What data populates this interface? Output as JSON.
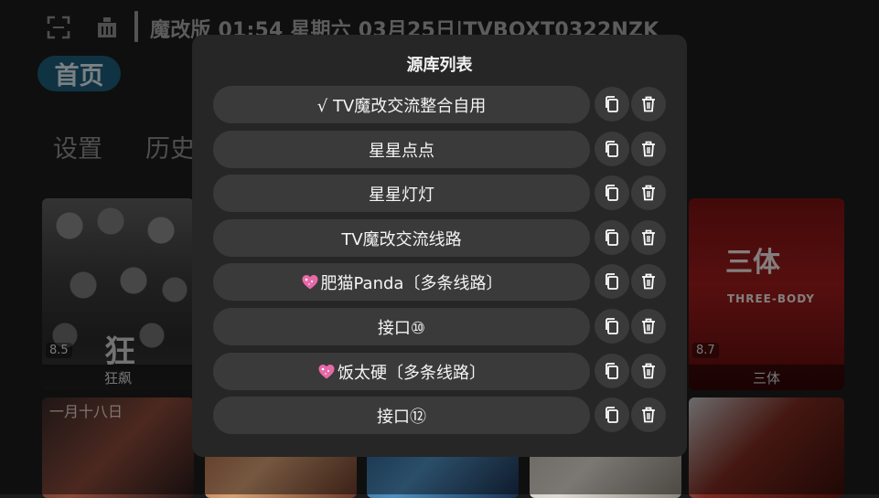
{
  "header": {
    "title_line": "魔改版 01:54 星期六 03月25日|TVBOXT0322NZK"
  },
  "nav": {
    "home": "首页",
    "settings": "设置",
    "history": "历史"
  },
  "posters": [
    {
      "title": "狂飙",
      "rating": "8.5",
      "art_text": "狂"
    },
    {
      "title": "三体",
      "rating": "8.7",
      "art_text": "三体",
      "art_sub": "THREE-BODY"
    }
  ],
  "row2": {
    "first_text": "一月十八日"
  },
  "dialog": {
    "title": "源库列表",
    "items": [
      {
        "label": "√ TV魔改交流整合自用",
        "icon": ""
      },
      {
        "label": "星星点点",
        "icon": ""
      },
      {
        "label": "星星灯灯",
        "icon": ""
      },
      {
        "label": "TV魔改交流线路",
        "icon": ""
      },
      {
        "label": "肥猫Panda〔多条线路〕",
        "icon": "sparkling-heart-icon"
      },
      {
        "label": "接口⑩",
        "icon": ""
      },
      {
        "label": "饭太硬〔多条线路〕",
        "icon": "sparkling-heart-icon"
      },
      {
        "label": "接口⑫",
        "icon": ""
      }
    ],
    "accent_heart_color": "#e66aa8",
    "nav_active_color": "#1d5d7b"
  }
}
